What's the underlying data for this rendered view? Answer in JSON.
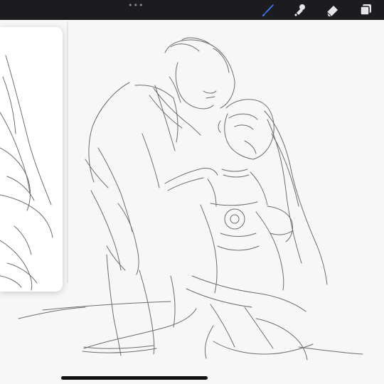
{
  "app": {
    "toolbar": {
      "menu_dots": "•••",
      "tools": [
        {
          "icon": "brush-icon",
          "active": true,
          "color": "#3a7bfd"
        },
        {
          "icon": "smudge-icon",
          "active": false,
          "color": "#e5e5ea"
        },
        {
          "icon": "eraser-icon",
          "active": false,
          "color": "#e5e5ea"
        },
        {
          "icon": "layers-icon",
          "active": false,
          "color": "#e5e5ea"
        }
      ]
    },
    "colors": {
      "toolbar_bg": "#1c1c1e",
      "canvas_bg": "#f7f7f7",
      "sketch_stroke": "#4a4a4a"
    }
  }
}
